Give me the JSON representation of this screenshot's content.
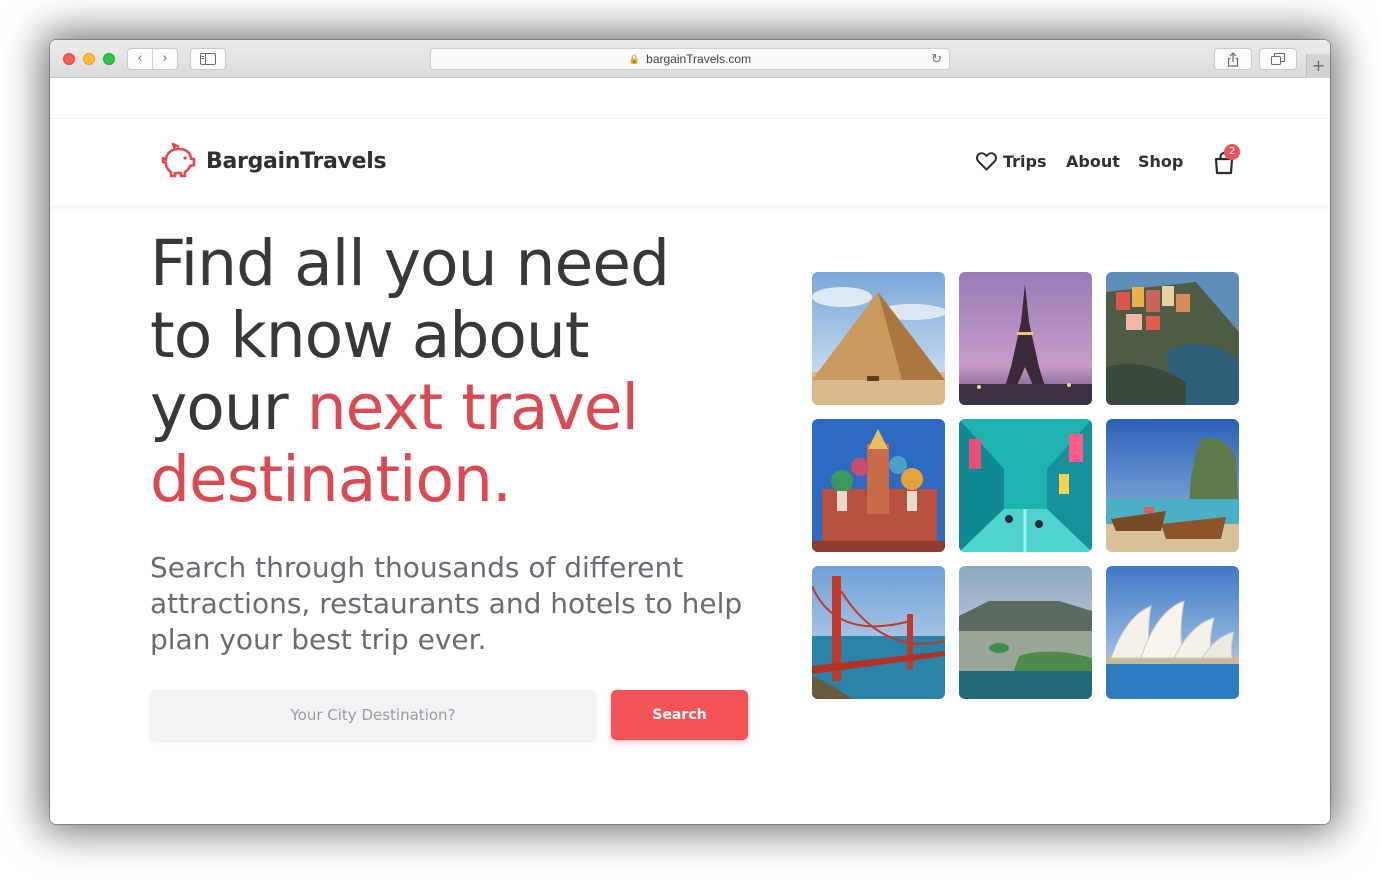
{
  "browser": {
    "url": "bargainTravels.com",
    "back_icon": "chevron-left-icon",
    "forward_icon": "chevron-right-icon"
  },
  "site": {
    "brand": "BargainTravels",
    "brand_color": "#e5484f",
    "nav": {
      "trips": "Trips",
      "about": "About",
      "shop": "Shop"
    },
    "cart_count": "2"
  },
  "hero": {
    "title_lines": [
      "Find all you need",
      "to know about",
      "your "
    ],
    "title_accent_1": "next travel",
    "title_accent_2": "destination.",
    "subtitle": "Search through thousands of different attractions, restaurants and hotels to help plan your best trip ever.",
    "accent_color": "#d94a52"
  },
  "search": {
    "placeholder": "Your City Destination?",
    "button_label": "Search"
  },
  "destinations": [
    "pyramid",
    "eiffel-tower",
    "cinque-terre",
    "st-basils-cathedral",
    "city-street",
    "thai-longtail-boats",
    "golden-gate-bridge",
    "cape-town",
    "sydney-opera-house"
  ]
}
